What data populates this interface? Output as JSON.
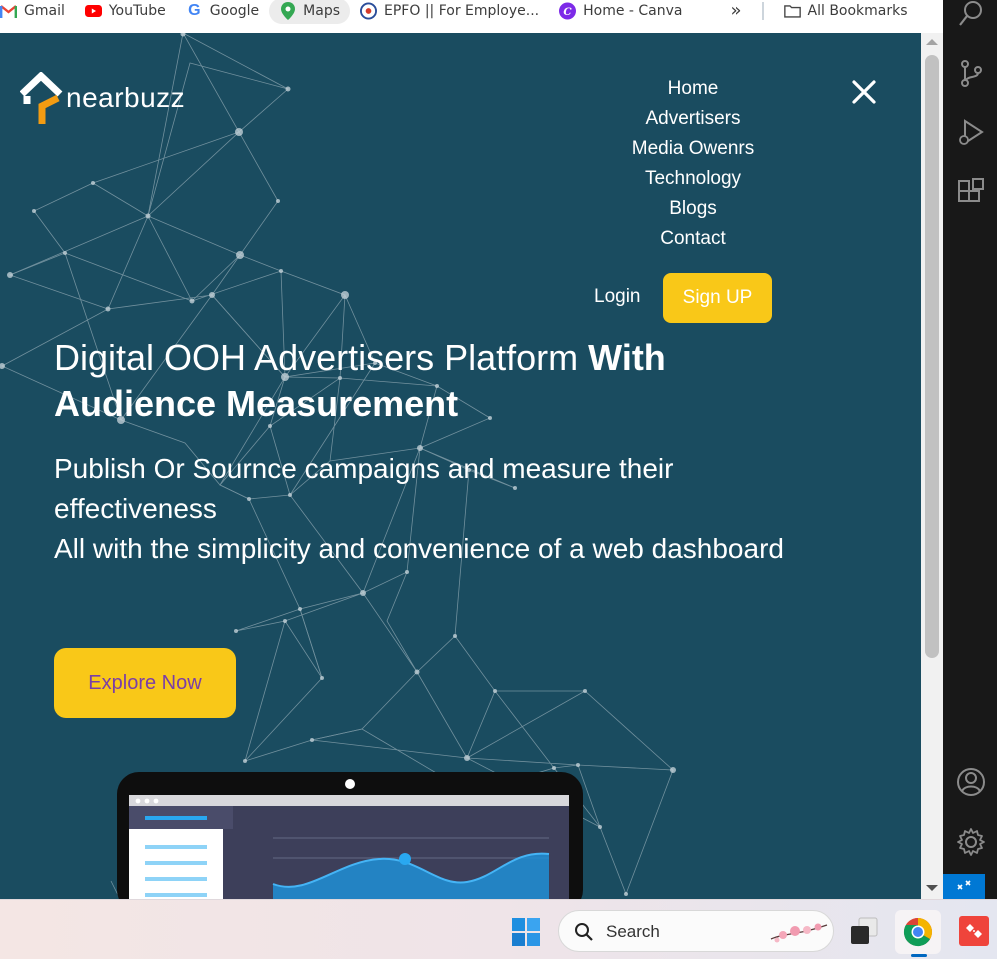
{
  "browser": {
    "bookmarks": [
      {
        "label": "Gmail",
        "icon": "gmail-icon"
      },
      {
        "label": "YouTube",
        "icon": "youtube-icon"
      },
      {
        "label": "Google",
        "icon": "google-icon"
      },
      {
        "label": "Maps",
        "icon": "maps-icon"
      },
      {
        "label": "EPFO || For Employe...",
        "icon": "epfo-icon"
      },
      {
        "label": "Home - Canva",
        "icon": "canva-icon"
      }
    ],
    "overflow_label": "»",
    "all_bookmarks_label": "All Bookmarks"
  },
  "site": {
    "brand": "nearbuzz",
    "nav": [
      "Home",
      "Advertisers",
      "Media Owenrs",
      "Technology",
      "Blogs",
      "Contact"
    ],
    "login_label": "Login",
    "signup_label": "Sign UP",
    "hero": {
      "title_regular": "Digital OOH Advertisers Platform ",
      "title_bold": "With Audience Measurement",
      "subtitle_line1": "Publish Or Sournce campaigns and measure their effectiveness",
      "subtitle_line2": "All with the simplicity and convenience of a web dashboard"
    },
    "explore_label": "Explore Now",
    "colors": {
      "background": "#1a4c60",
      "accent": "#f9c818",
      "explore_text": "#7a3ea8"
    }
  },
  "taskbar": {
    "search_label": "Search"
  }
}
